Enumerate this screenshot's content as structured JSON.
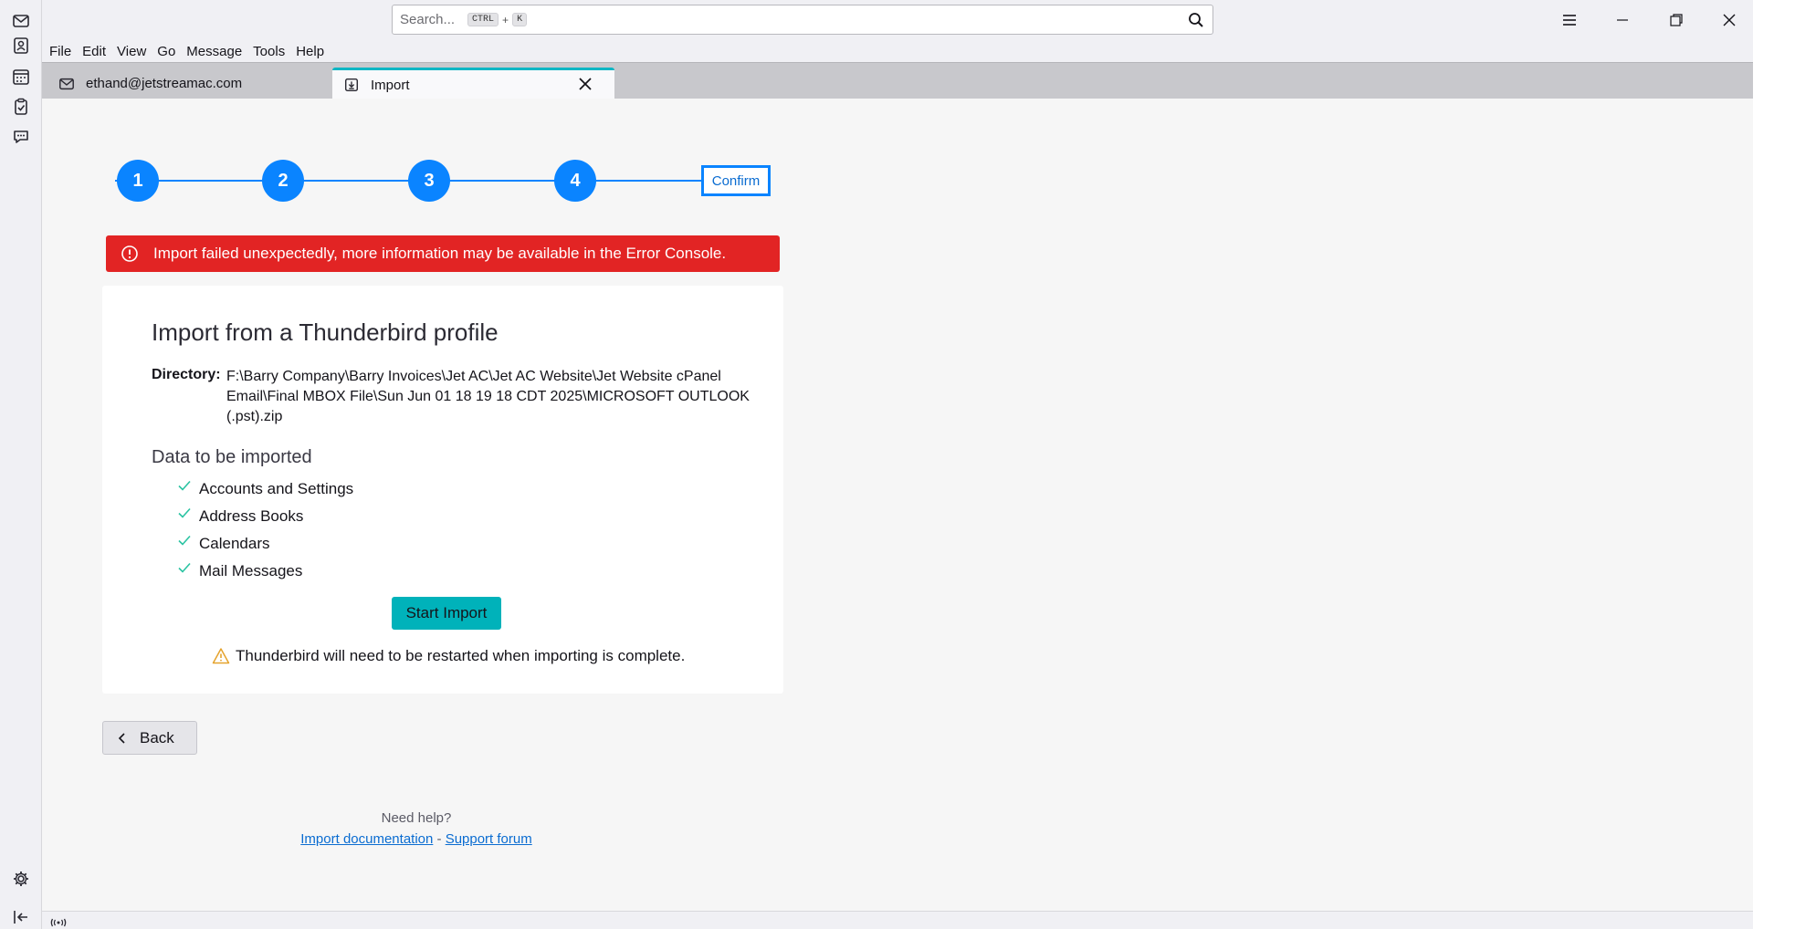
{
  "search": {
    "placeholder": "Search...",
    "key1": "CTRL",
    "plus": "+",
    "key2": "K"
  },
  "menu": [
    "File",
    "Edit",
    "View",
    "Go",
    "Message",
    "Tools",
    "Help"
  ],
  "tabs": [
    {
      "label": "ethand@jetstreamac.com"
    },
    {
      "label": "Import"
    }
  ],
  "steps": [
    "1",
    "2",
    "3",
    "4"
  ],
  "confirm_label": "Confirm",
  "error_message": "Import failed unexpectedly, more information may be available in the Error Console.",
  "card": {
    "title": "Import from a Thunderbird profile",
    "directory_label": "Directory:",
    "directory_value": "F:\\Barry Company\\Barry Invoices\\Jet AC\\Jet AC Website\\Jet Website cPanel Email\\Final MBOX File\\Sun Jun 01 18 19 18 CDT 2025\\MICROSOFT OUTLOOK (.pst).zip",
    "data_heading": "Data to be imported",
    "items": [
      "Accounts and Settings",
      "Address Books",
      "Calendars",
      "Mail Messages"
    ],
    "start_label": "Start Import",
    "restart_note": "Thunderbird will need to be restarted when importing is complete."
  },
  "back_label": "Back",
  "help": {
    "need_help": "Need help?",
    "doc_link": "Import documentation",
    "separator": "-",
    "forum_link": "Support forum"
  },
  "colors": {
    "accent": "#0a84ff",
    "error": "#e22424",
    "start_button": "#00b2ba",
    "check": "#2ac3a2",
    "warning": "#e5a32d"
  },
  "icons": [
    "mail-icon",
    "address-book-icon",
    "calendar-icon",
    "tasks-icon",
    "chat-icon",
    "settings-icon",
    "collapse-icon",
    "search-icon",
    "menu-icon",
    "minimize-icon",
    "restore-icon",
    "close-icon",
    "import-tab-icon",
    "error-icon",
    "check-icon",
    "warning-icon",
    "chevron-left-icon",
    "online-status-icon"
  ]
}
